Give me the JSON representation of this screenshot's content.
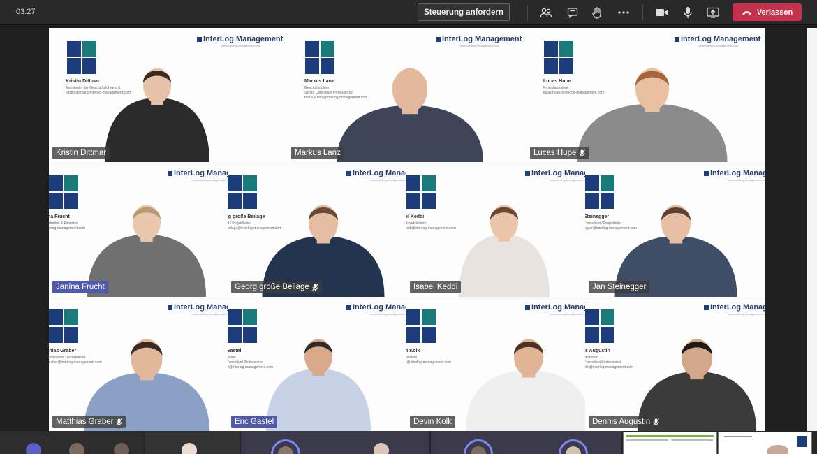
{
  "meeting": {
    "timer": "03:27",
    "request_control_label": "Steuerung anfordern",
    "leave_label": "Verlassen"
  },
  "toolbar_icons": [
    "participants-icon",
    "chat-icon",
    "raise-hand-icon",
    "more-options-icon",
    "camera-icon",
    "microphone-icon",
    "share-screen-icon",
    "hang-up-icon"
  ],
  "colors": {
    "leave_red": "#c4314b",
    "speaking_highlight": "#5059aa",
    "brand_navy": "#1c3c7c",
    "brand_teal": "#1a7a7a"
  },
  "branding": {
    "company": "InterLog Management",
    "company_cut": "InterLog Managem",
    "url": "www.interlog-management.com"
  },
  "participants": [
    {
      "name": "Kristin Dittmar",
      "card_name": "Kristin Dittmar",
      "card_role": "Assistentin der Geschäftsführung &",
      "card_email": "kristin.dittmar@interlog-management.com",
      "muted": false,
      "speaking": false
    },
    {
      "name": "Markus Lanz",
      "card_name": "Markus Lanz",
      "card_role": "Geschäftsführer",
      "card_role2": "Senior Consultant Professional",
      "card_email": "markus.lanz@interlog-management.com",
      "muted": false,
      "speaking": false
    },
    {
      "name": "Lucas Hupe",
      "card_name": "Lucas Hupe",
      "card_role": "Projektassistent",
      "card_email": "lucas.hupe@interlog-management.com",
      "muted": true,
      "speaking": false
    },
    {
      "name": "Janina Frucht",
      "card_name": "na Frucht",
      "card_role": "istration & Finanzen",
      "card_email": "lerlog-management.com",
      "muted": false,
      "speaking": true
    },
    {
      "name": "Georg große Beilage",
      "card_name": "rg große Beilage",
      "card_role": "nt / Projektleiter",
      "card_email": "beilage@interlog-management.com",
      "muted": true,
      "speaking": false
    },
    {
      "name": "Isabel Keddi",
      "card_name": "el Keddi",
      "card_role": "Projektleiterin",
      "card_email": "eddi@interlog-management.com",
      "muted": false,
      "speaking": false
    },
    {
      "name": "Jan Steinegger",
      "card_name": "Steinegger",
      "card_role": "Consultant / Projektleiter",
      "card_email": "egger@interlog-management.com",
      "muted": false,
      "speaking": false
    },
    {
      "name": "Matthias Graber",
      "card_name": "thias Graber",
      "card_role": "Consultant / Projektleiter",
      "card_email": "graber@interlog-management.com",
      "muted": true,
      "speaking": false
    },
    {
      "name": "Eric Gastel",
      "card_name": "Gastel",
      "card_role": "ihaber",
      "card_role2": "Consultant Professional",
      "card_email": "el@interlog-management.com",
      "muted": false,
      "speaking": true
    },
    {
      "name": "Devin Kolk",
      "card_name": "n Kolk",
      "card_role": "ssistent",
      "card_email": "k@interlog-management.com",
      "muted": false,
      "speaking": false
    },
    {
      "name": "Dennis Augustin",
      "card_name": "is Augustin",
      "card_role": "äftsführer",
      "card_role2": "Consultant Professional",
      "card_email": "stin@interlog-management.com",
      "muted": true,
      "speaking": false
    }
  ]
}
